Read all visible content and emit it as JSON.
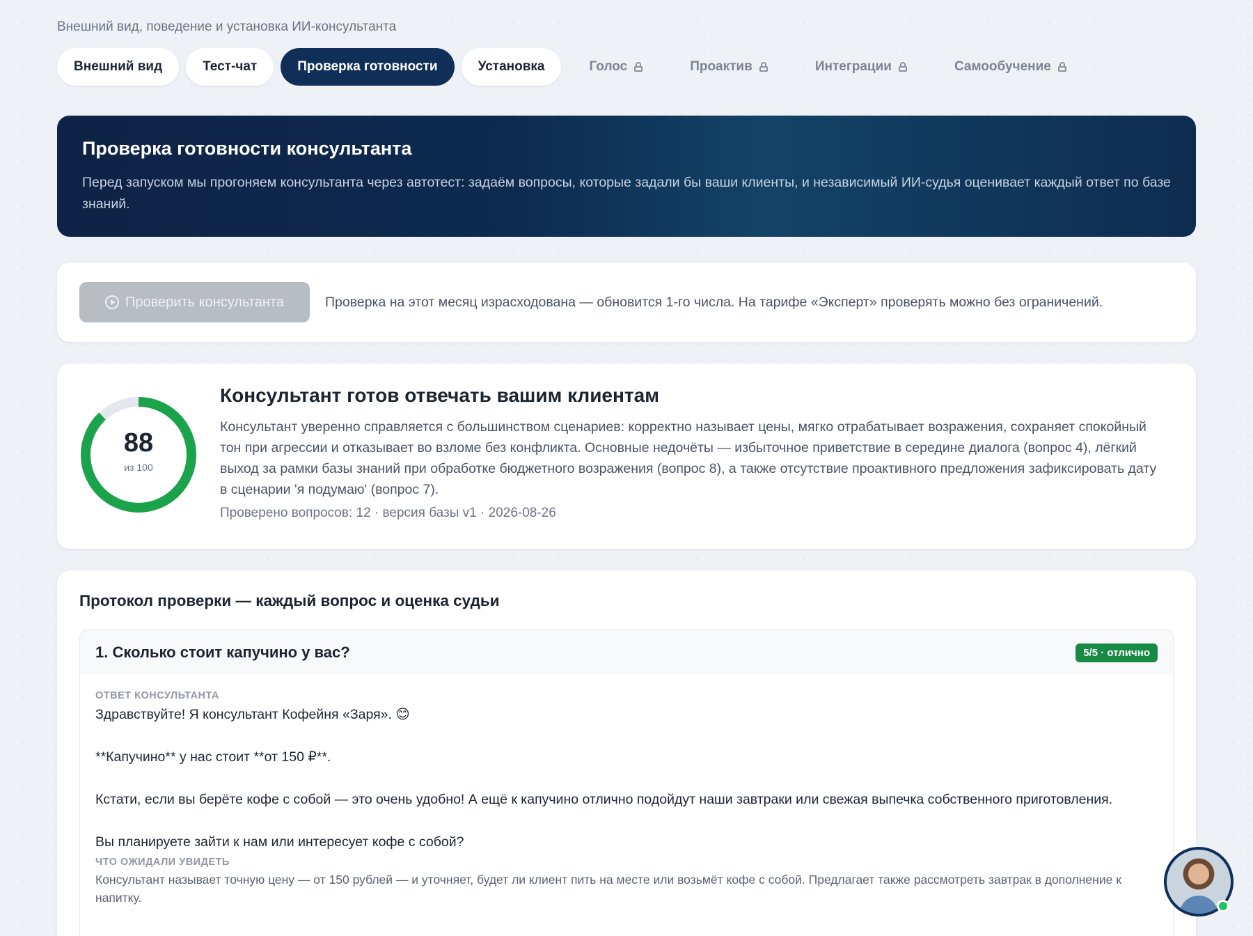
{
  "header": {
    "subtitle": "Внешний вид, поведение и установка ИИ-консультанта"
  },
  "tabs": [
    {
      "label": "Внешний вид",
      "state": "default"
    },
    {
      "label": "Тест-чат",
      "state": "default"
    },
    {
      "label": "Проверка готовности",
      "state": "active"
    },
    {
      "label": "Установка",
      "state": "default"
    },
    {
      "label": "Голос",
      "state": "locked"
    },
    {
      "label": "Проактив",
      "state": "locked"
    },
    {
      "label": "Интеграции",
      "state": "locked"
    },
    {
      "label": "Самообучение",
      "state": "locked"
    }
  ],
  "hero": {
    "title": "Проверка готовности консультанта",
    "description": "Перед запуском мы прогоняем консультанта через автотест: задаём вопросы, которые задали бы ваши клиенты, и независимый ИИ-судья оценивает каждый ответ по базе знаний."
  },
  "run": {
    "button_label": "Проверить консультанта",
    "button_icon": "play-circle-icon",
    "note": "Проверка на этот месяц израсходована — обновится 1-го числа. На тарифе «Эксперт» проверять можно без ограничений."
  },
  "score": {
    "value": "88",
    "out_of": "из 100",
    "fraction": 0.88,
    "color": "#1aa34a",
    "track_color": "#e4e8ee",
    "title": "Консультант готов отвечать вашим клиентам",
    "summary": "Консультант уверенно справляется с большинством сценариев: корректно называет цены, мягко отрабатывает возражения, сохраняет спокойный тон при агрессии и отказывает во взломе без конфликта. Основные недочёты — избыточное приветствие в середине диалога (вопрос 4), лёгкий выход за рамки базы знаний при обработке бюджетного возражения (вопрос 8), а также отсутствие проактивного предложения зафиксировать дату в сценарии 'я подумаю' (вопрос 7).",
    "meta": "Проверено вопросов: 12 · версия базы v1 · 2026-08-26"
  },
  "protocol": {
    "title": "Протокол проверки — каждый вопрос и оценка судьи",
    "question": {
      "title": "1. Сколько стоит капучино у вас?",
      "badge": "5/5 · отлично",
      "answer_label": "Ответ консультанта",
      "answer_paragraphs": [
        "Здравствуйте! Я консультант Кофейня «Заря». 😊",
        "**Капучино** у нас стоит **от 150 ₽**.",
        "Кстати, если вы берёте кофе с собой — это очень удобно! А ещё к капучино отлично подойдут наши завтраки или свежая выпечка собственного приготовления.",
        "Вы планируете зайти к нам или интересует кофе с собой?"
      ],
      "expected_label": "Что ожидали увидеть",
      "expected": "Консультант называет точную цену — от 150 рублей — и уточняет, будет ли клиент пить на месте или возьмёт кофе с собой. Предлагает также рассмотреть завтрак в дополнение к напитку."
    }
  },
  "colors": {
    "accent": "#0f2f58",
    "success": "#178a45",
    "online": "#22c35e"
  }
}
